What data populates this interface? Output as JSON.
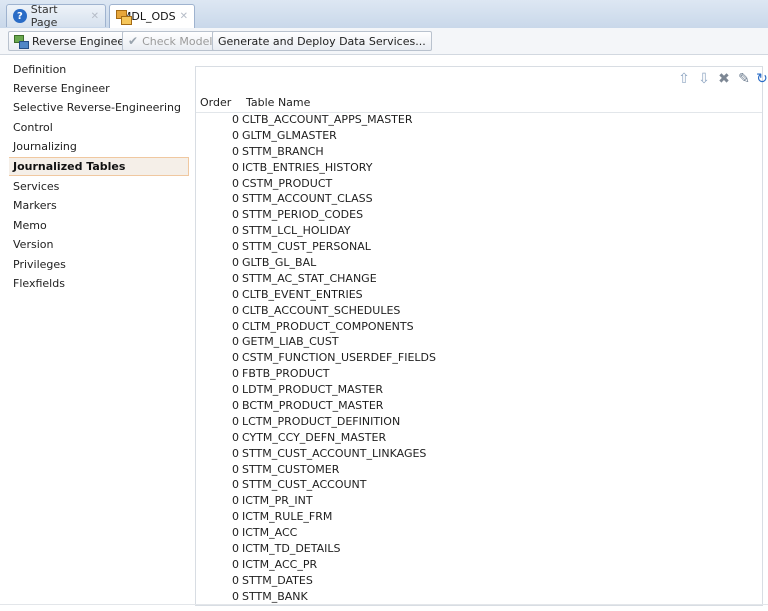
{
  "tabs": [
    {
      "label": "Start Page",
      "icon": "help-icon",
      "active": false
    },
    {
      "label": "MDL_ODS",
      "icon": "model-icon",
      "active": true
    }
  ],
  "toolbar": {
    "reverse_engineer": "Reverse Engineer",
    "check_model": "Check Model",
    "generate_deploy": "Generate and Deploy Data Services..."
  },
  "nav": {
    "items": [
      {
        "label": "Definition"
      },
      {
        "label": "Reverse Engineer"
      },
      {
        "label": "Selective Reverse-Engineering"
      },
      {
        "label": "Control"
      },
      {
        "label": "Journalizing"
      },
      {
        "label": "Journalized Tables",
        "selected": true
      },
      {
        "label": "Services"
      },
      {
        "label": "Markers"
      },
      {
        "label": "Memo"
      },
      {
        "label": "Version"
      },
      {
        "label": "Privileges"
      },
      {
        "label": "Flexfields"
      }
    ]
  },
  "panel_icons": [
    "move-up-icon",
    "move-down-icon",
    "delete-icon",
    "edit-icon",
    "refresh-icon"
  ],
  "colors": {
    "selected_bg": "#f5efe8",
    "selected_border": "#f0c8a0",
    "accent": "#2a6cc6"
  },
  "table": {
    "headers": {
      "order": "Order",
      "name": "Table Name"
    },
    "rows": [
      {
        "order": "0",
        "name": "CLTB_ACCOUNT_APPS_MASTER"
      },
      {
        "order": "0",
        "name": "GLTM_GLMASTER"
      },
      {
        "order": "0",
        "name": "STTM_BRANCH"
      },
      {
        "order": "0",
        "name": "ICTB_ENTRIES_HISTORY"
      },
      {
        "order": "0",
        "name": "CSTM_PRODUCT"
      },
      {
        "order": "0",
        "name": "STTM_ACCOUNT_CLASS"
      },
      {
        "order": "0",
        "name": "STTM_PERIOD_CODES"
      },
      {
        "order": "0",
        "name": "STTM_LCL_HOLIDAY"
      },
      {
        "order": "0",
        "name": "STTM_CUST_PERSONAL"
      },
      {
        "order": "0",
        "name": "GLTB_GL_BAL"
      },
      {
        "order": "0",
        "name": "STTM_AC_STAT_CHANGE"
      },
      {
        "order": "0",
        "name": "CLTB_EVENT_ENTRIES"
      },
      {
        "order": "0",
        "name": "CLTB_ACCOUNT_SCHEDULES"
      },
      {
        "order": "0",
        "name": "CLTM_PRODUCT_COMPONENTS"
      },
      {
        "order": "0",
        "name": "GETM_LIAB_CUST"
      },
      {
        "order": "0",
        "name": "CSTM_FUNCTION_USERDEF_FIELDS"
      },
      {
        "order": "0",
        "name": "FBTB_PRODUCT"
      },
      {
        "order": "0",
        "name": "LDTM_PRODUCT_MASTER"
      },
      {
        "order": "0",
        "name": "BCTM_PRODUCT_MASTER"
      },
      {
        "order": "0",
        "name": "LCTM_PRODUCT_DEFINITION"
      },
      {
        "order": "0",
        "name": "CYTM_CCY_DEFN_MASTER"
      },
      {
        "order": "0",
        "name": "STTM_CUST_ACCOUNT_LINKAGES"
      },
      {
        "order": "0",
        "name": "STTM_CUSTOMER"
      },
      {
        "order": "0",
        "name": "STTM_CUST_ACCOUNT"
      },
      {
        "order": "0",
        "name": "ICTM_PR_INT"
      },
      {
        "order": "0",
        "name": "ICTM_RULE_FRM"
      },
      {
        "order": "0",
        "name": "ICTM_ACC"
      },
      {
        "order": "0",
        "name": "ICTM_TD_DETAILS"
      },
      {
        "order": "0",
        "name": "ICTM_ACC_PR"
      },
      {
        "order": "0",
        "name": "STTM_DATES"
      },
      {
        "order": "0",
        "name": "STTM_BANK"
      }
    ]
  }
}
